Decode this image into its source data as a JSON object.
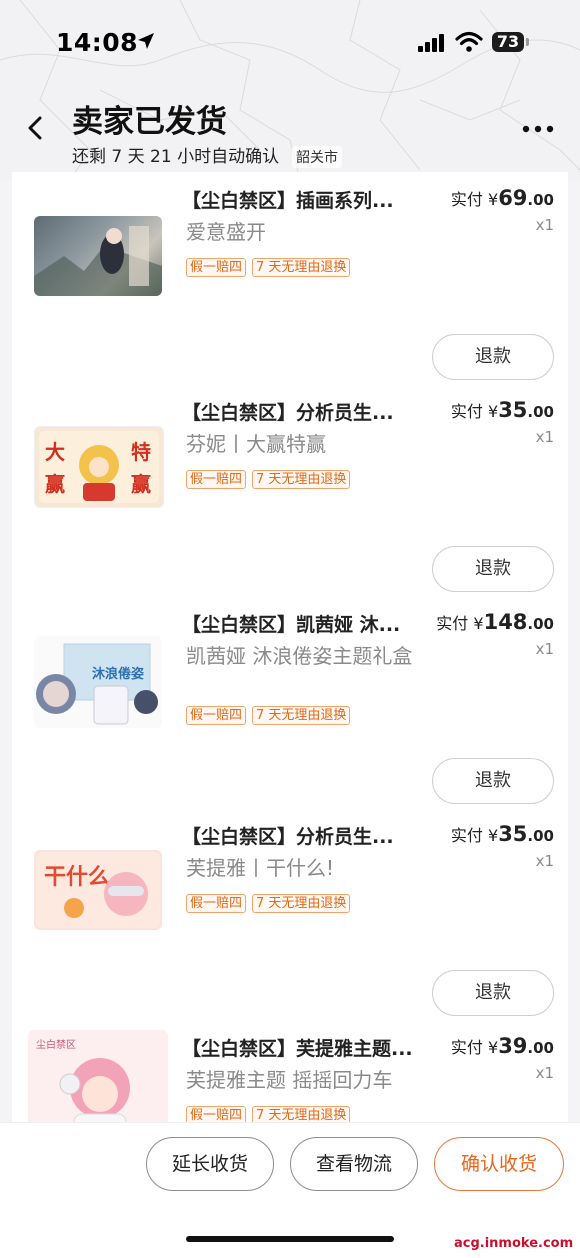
{
  "status": {
    "time": "14:08",
    "battery": "73"
  },
  "header": {
    "title": "卖家已发货",
    "subtitle": "还剩 7 天 21 小时自动确认",
    "city": "韶关市"
  },
  "items": [
    {
      "name": "【尘白禁区】插画系列...",
      "spec": "爱意盛开",
      "tags": [
        "假一赔四",
        "7 天无理由退换"
      ],
      "price_prefix": "实付 ¥",
      "price_int": "69",
      "price_dec": ".00",
      "qty": "x1",
      "refund": "退款"
    },
    {
      "name": "【尘白禁区】分析员生...",
      "spec": "芬妮丨大赢特赢",
      "tags": [
        "假一赔四",
        "7 天无理由退换"
      ],
      "price_prefix": "实付 ¥",
      "price_int": "35",
      "price_dec": ".00",
      "qty": "x1",
      "refund": "退款"
    },
    {
      "name": "【尘白禁区】凯茜娅 沐...",
      "spec": "凯茜娅 沐浪倦姿主题礼盒",
      "tags": [
        "假一赔四",
        "7 天无理由退换"
      ],
      "price_prefix": "实付 ¥",
      "price_int": "148",
      "price_dec": ".00",
      "qty": "x1",
      "refund": "退款"
    },
    {
      "name": "【尘白禁区】分析员生...",
      "spec": "芙提雅丨干什么!",
      "tags": [
        "假一赔四",
        "7 天无理由退换"
      ],
      "price_prefix": "实付 ¥",
      "price_int": "35",
      "price_dec": ".00",
      "qty": "x1",
      "refund": "退款"
    },
    {
      "name": "【尘白禁区】芙提雅主题...",
      "spec": "芙提雅主题 摇摇回力车",
      "tags": [
        "假一赔四",
        "7 天无理由退换"
      ],
      "price_prefix": "实付 ¥",
      "price_int": "39",
      "price_dec": ".00",
      "qty": "x1"
    }
  ],
  "thumb_text": {
    "fenny": [
      "大",
      "特",
      "赢",
      "赢"
    ],
    "futiya": "干什么",
    "kathya": "沐浪倦姿",
    "last": "尘白禁区"
  },
  "actions": {
    "extend": "延长收货",
    "logistics": "查看物流",
    "confirm": "确认收货"
  },
  "watermark": "acg.inmoke.com",
  "colors": {
    "accent": "#e8661c",
    "tag": "#e06a1a"
  }
}
